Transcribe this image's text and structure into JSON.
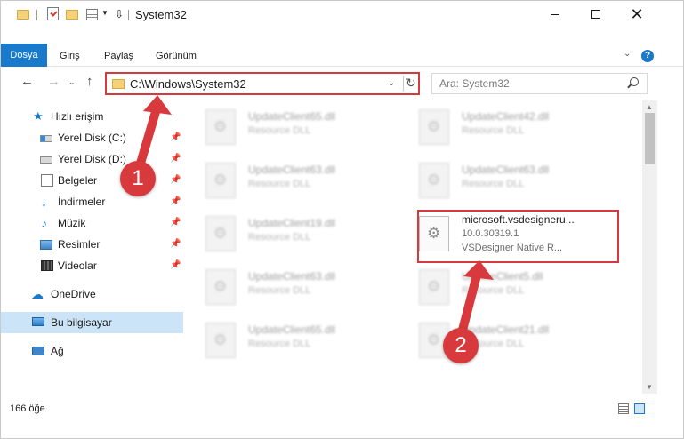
{
  "window": {
    "title": "System32"
  },
  "ribbon": {
    "tabs": [
      {
        "label": "Dosya"
      },
      {
        "label": "Giriş"
      },
      {
        "label": "Paylaş"
      },
      {
        "label": "Görünüm"
      }
    ],
    "help_label": "?"
  },
  "nav": {
    "address": "C:\\Windows\\System32",
    "search_placeholder": "Ara: System32"
  },
  "sidebar": {
    "items": [
      {
        "label": "Hızlı erişim",
        "icon": "star-icon",
        "pinned": false
      },
      {
        "label": "Yerel Disk (C:)",
        "icon": "disk-icon",
        "pinned": true
      },
      {
        "label": "Yerel Disk (D:)",
        "icon": "disk-icon",
        "pinned": true
      },
      {
        "label": "Belgeler",
        "icon": "documents-icon",
        "pinned": true
      },
      {
        "label": "İndirmeler",
        "icon": "downloads-icon",
        "pinned": true
      },
      {
        "label": "Müzik",
        "icon": "music-icon",
        "pinned": true
      },
      {
        "label": "Resimler",
        "icon": "pictures-icon",
        "pinned": true
      },
      {
        "label": "Videolar",
        "icon": "videos-icon",
        "pinned": true
      },
      {
        "label": "OneDrive",
        "icon": "cloud-icon",
        "pinned": false
      },
      {
        "label": "Bu bilgisayar",
        "icon": "computer-icon",
        "pinned": false,
        "selected": true
      },
      {
        "label": "Ağ",
        "icon": "network-icon",
        "pinned": false
      }
    ]
  },
  "files": [
    {
      "name": "UpdateClient65.dll",
      "type": "Resource DLL"
    },
    {
      "name": "UpdateClient42.dll",
      "type": "Resource DLL"
    },
    {
      "name": "UpdateClient63.dll",
      "type": "Resource DLL"
    },
    {
      "name": "UpdateClient63.dll",
      "type": "Resource DLL"
    },
    {
      "name": "UpdateClient19.dll",
      "type": "Resource DLL"
    },
    {
      "name": "microsoft.vsdesigneru...",
      "version": "10.0.30319.1",
      "type": "VSDesigner Native R..."
    },
    {
      "name": "UpdateClient63.dll",
      "type": "Resource DLL"
    },
    {
      "name": "UpdateClient5.dll",
      "type": "Resource DLL"
    },
    {
      "name": "UpdateClient65.dll",
      "type": "Resource DLL"
    },
    {
      "name": "UpdateClient21.dll",
      "type": "Resource DLL"
    }
  ],
  "status": {
    "count": "166 öğe"
  },
  "annotations": {
    "step1": "1",
    "step2": "2",
    "color": "#d8393c"
  },
  "colors": {
    "accent": "#1979ca",
    "selection": "#cce4f7",
    "highlight": "#d8393c"
  }
}
